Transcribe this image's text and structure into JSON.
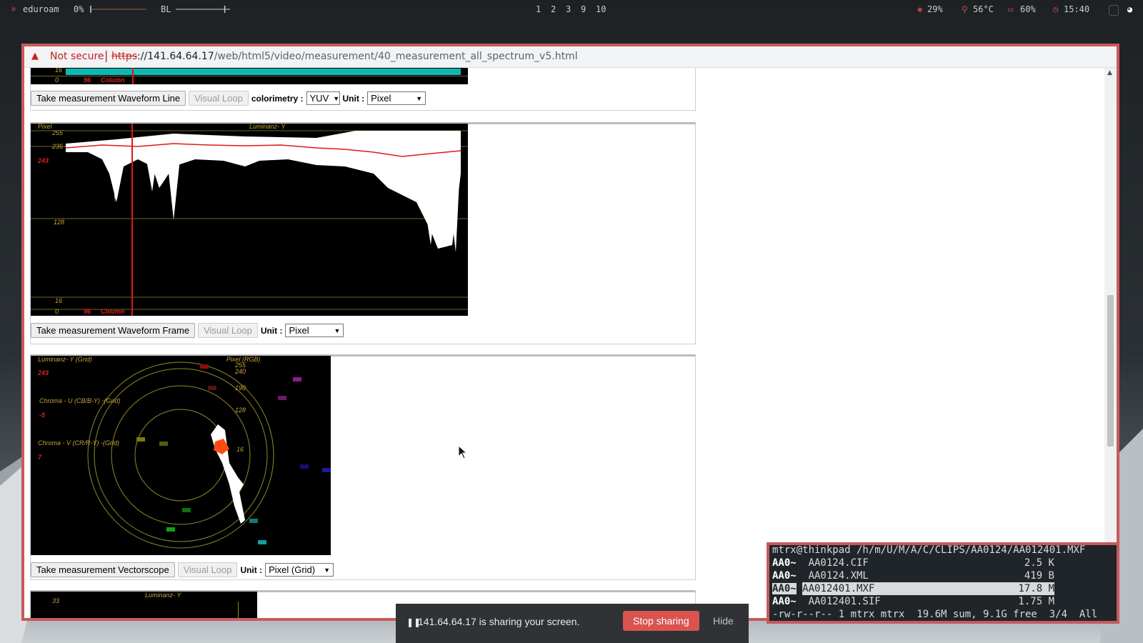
{
  "topbar": {
    "wifi_name": "eduroam",
    "volume": "0%",
    "volume_level": 0,
    "brightness_label": "BL",
    "brightness_level": 0.9,
    "workspaces": [
      "1",
      "2",
      "3",
      "9",
      "10"
    ],
    "cpu": "29%",
    "temperature": "56°C",
    "battery": "60%",
    "clock": "15:40"
  },
  "browser": {
    "security_label": "Not secure",
    "url_protocol": "https",
    "url_host": "://141.64.64.17",
    "url_path": "/web/html5/video/measurement/40_measurement_all_spectrum_v5.html"
  },
  "panel1": {
    "bottom_labels": {
      "zero": "0",
      "column_value": "96",
      "column": "Column",
      "top": "16"
    },
    "take_button": "Take measurement Waveform Line",
    "loop_button": "Visual Loop",
    "colorimetry_label": "colorimetry :",
    "colorimetry_value": "YUV",
    "unit_label": "Unit :",
    "unit_value": "Pixel"
  },
  "panel2": {
    "labels": {
      "pixel": "Pixel",
      "luminance": "Luminanz- Y",
      "y255": "255",
      "y235": "235",
      "y243": "243",
      "y128": "128",
      "y16": "16",
      "zero": "0",
      "column_value": "96",
      "column": "Column"
    },
    "take_button": "Take measurement Waveform Frame",
    "loop_button": "Visual Loop",
    "unit_label": "Unit :",
    "unit_value": "Pixel"
  },
  "panel3": {
    "labels": {
      "luminance": "Luminanz- Y (Grid)",
      "lum_value": "243",
      "pixel_rgb": "Pixel (RGB)",
      "chroma_u": "Chroma - U (CB/B-Y) -(Grid)",
      "chroma_u_value": "-5",
      "chroma_v": "Chroma - V (CR/R-Y) -(Grid)",
      "chroma_v_value": "7",
      "r255": "255",
      "r240": "240",
      "r190": "190",
      "r128": "128",
      "r16": "16"
    },
    "take_button": "Take measurement Vectorscope",
    "loop_button": "Visual Loop",
    "unit_label": "Unit :",
    "unit_value": "Pixel (Grid)"
  },
  "panel4": {
    "luminance": "Luminanz- Y",
    "y33": "33"
  },
  "terminal": {
    "path": "mtrx@thinkpad /h/m/U/M/A/C/CLIPS/AA0124/AA012401.MXF",
    "files": [
      {
        "tag": "AA0~",
        "name": "AA0124.CIF",
        "size": "2.5 K"
      },
      {
        "tag": "AA0~",
        "name": "AA0124.XML",
        "size": "419 B"
      },
      {
        "tag": "AA0~",
        "name": "AA012401.MXF",
        "size": "17.8 M"
      },
      {
        "tag": "AA0~",
        "name": "AA012401.SIF",
        "size": "1.75 M"
      }
    ],
    "status": "-rw-r--r-- 1 mtrx mtrx  19.6M sum, 9.1G free  3/4  All"
  },
  "sharebar": {
    "message": "141.64.64.17 is sharing your screen.",
    "stop_button": "Stop sharing",
    "hide_button": "Hide"
  }
}
